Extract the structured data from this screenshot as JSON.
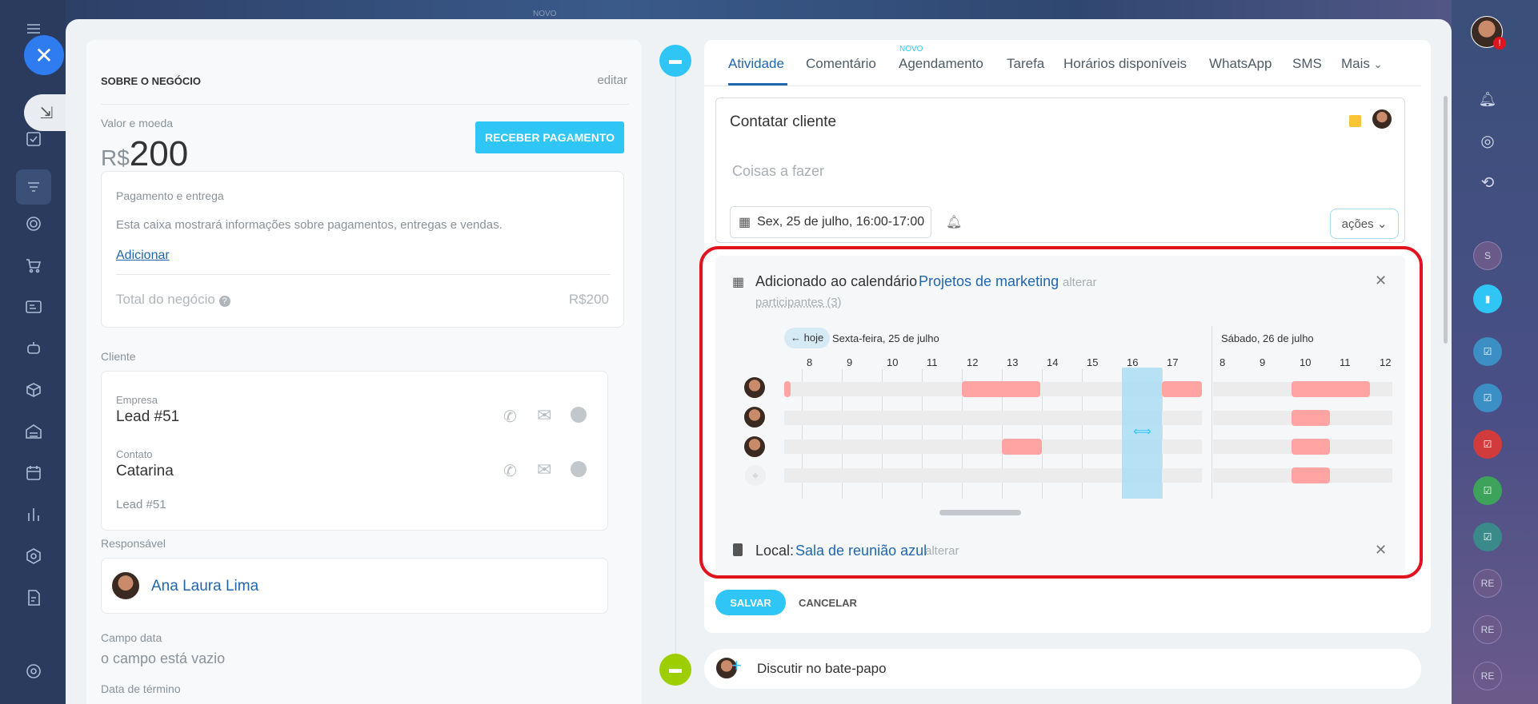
{
  "left": {
    "section_title": "SOBRE O NEGÓCIO",
    "edit": "editar",
    "value_label": "Valor e moeda",
    "currency": "R$",
    "amount": "200",
    "receive_btn": "RECEBER PAGAMENTO",
    "payment_title": "Pagamento e entrega",
    "payment_desc": "Esta caixa mostrará informações sobre pagamentos, entregas e vendas.",
    "add_link": "Adicionar",
    "total_label": "Total do negócio",
    "total_value": "R$200",
    "client_label": "Cliente",
    "company_label": "Empresa",
    "company_name": "Lead #51",
    "contact_label": "Contato",
    "contact_name": "Catarina",
    "contact_sub": "Lead #51",
    "responsible_label": "Responsável",
    "responsible_name": "Ana Laura Lima",
    "date_field_label": "Campo data",
    "date_field_value": "o campo está vazio",
    "end_date_label": "Data de término"
  },
  "tabs": {
    "new_badge": "NOVO",
    "items": [
      "Atividade",
      "Comentário",
      "Agendamento",
      "Tarefa",
      "Horários disponíveis",
      "WhatsApp",
      "SMS",
      "Mais"
    ]
  },
  "task": {
    "title": "Contatar cliente",
    "placeholder": "Coisas a fazer",
    "datetime": "Sex, 25 de julho, 16:00-17:00",
    "actions": "ações"
  },
  "calendar": {
    "added_label": "Adicionado ao calendário",
    "calendar_name": "Projetos de marketing",
    "change": "alterar",
    "participants": "participantes (3)",
    "today": "← hoje",
    "day1": "Sexta-feira, 25 de julho",
    "day2": "Sábado, 26 de julho",
    "hours1": [
      "8",
      "9",
      "10",
      "11",
      "12",
      "13",
      "14",
      "15",
      "16",
      "17"
    ],
    "hours2": [
      "8",
      "9",
      "10",
      "11",
      "12"
    ],
    "location_label": "Local:",
    "location_name": "Sala de reunião azul",
    "location_change": "alterar"
  },
  "buttons": {
    "save": "SALVAR",
    "cancel": "CANCELAR"
  },
  "chat": {
    "discuss": "Discutir no bate-papo"
  },
  "top": {
    "novo": "NOVO"
  },
  "rightbar": {
    "s": "S",
    "re1": "RE",
    "re2": "RE",
    "re3": "RE"
  },
  "colors": {
    "accent": "#2fc6f6",
    "busy": "#ffa3a3",
    "highlight": "#e0141e",
    "link": "#2067b0"
  }
}
